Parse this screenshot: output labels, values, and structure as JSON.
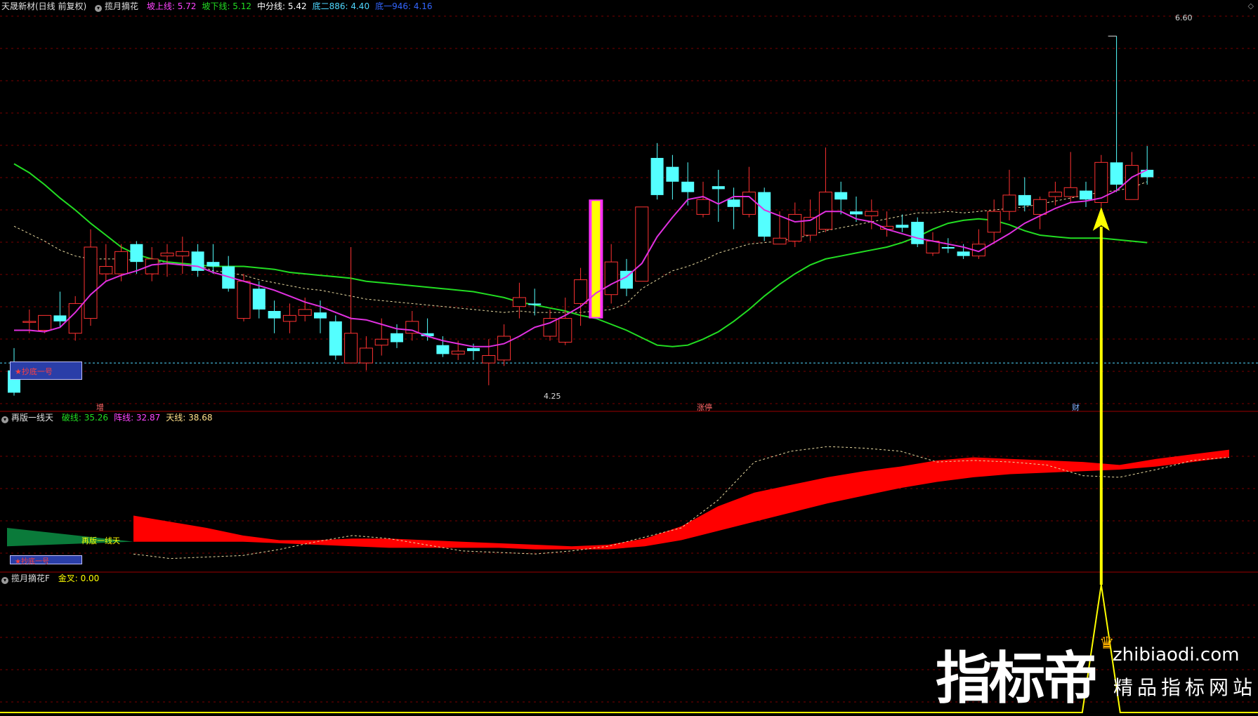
{
  "panel1": {
    "stock_name": "天晟新材(日线 前复权)",
    "indicator_name": "揽月摘花",
    "items": [
      {
        "label": "坡上线:",
        "value": "5.72",
        "color": "#ff44ff"
      },
      {
        "label": "坡下线:",
        "value": "5.12",
        "color": "#22dd22"
      },
      {
        "label": "中分线:",
        "value": "5.42",
        "color": "#ffffff"
      },
      {
        "label": "底二886:",
        "value": "4.40",
        "color": "#4fd8ff"
      },
      {
        "label": "底一946:",
        "value": "4.16",
        "color": "#3366ff"
      }
    ],
    "high_label": "6.60",
    "low_label": "4.25",
    "buy_box": "★抄底一号",
    "markers": [
      {
        "text": "增",
        "color": "#ff6a6a"
      },
      {
        "text": "涨停",
        "color": "#ff6a6a"
      },
      {
        "text": "财",
        "color": "#7fb0ff"
      }
    ]
  },
  "panel2": {
    "name": "再版一线天",
    "items": [
      {
        "label": "破线:",
        "value": "35.26",
        "color": "#22dd22"
      },
      {
        "label": "阵线:",
        "value": "32.87",
        "color": "#ff44ff"
      },
      {
        "label": "天线:",
        "value": "38.68",
        "color": "#ffe08a"
      }
    ],
    "inline_label": "再版一线天",
    "buy_box": "★抄底一号"
  },
  "panel3": {
    "name": "揽月摘花F",
    "items": [
      {
        "label": "金叉:",
        "value": "0.00",
        "color": "#ffff00"
      }
    ]
  },
  "watermark": {
    "brand": "指标帝",
    "domain": "zhibiaodi.com",
    "slogan": "精品指标网站"
  },
  "colors": {
    "up": "#ff3232",
    "down": "#54ffff",
    "grid": "#7a0000",
    "ma_purple": "#e030e0",
    "ma_green": "#22dd22",
    "arrow": "#ffff00"
  },
  "chart_data": {
    "type": "candlestick",
    "candles": [
      [
        4.35,
        4.2,
        4.5,
        4.18
      ],
      [
        4.68,
        4.68,
        4.76,
        4.6
      ],
      [
        4.62,
        4.72,
        4.72,
        4.6
      ],
      [
        4.72,
        4.68,
        4.88,
        4.64
      ],
      [
        4.6,
        4.8,
        4.85,
        4.55
      ],
      [
        4.7,
        5.18,
        5.3,
        4.65
      ],
      [
        5.0,
        5.05,
        5.2,
        4.95
      ],
      [
        5.0,
        5.15,
        5.2,
        4.95
      ],
      [
        5.2,
        5.08,
        5.22,
        5.0
      ],
      [
        5.0,
        5.1,
        5.18,
        4.95
      ],
      [
        5.12,
        5.14,
        5.2,
        4.98
      ],
      [
        5.12,
        5.15,
        5.25,
        5.0
      ],
      [
        5.15,
        5.02,
        5.2,
        4.98
      ],
      [
        5.08,
        5.05,
        5.2,
        5.0
      ],
      [
        5.05,
        4.9,
        5.12,
        4.88
      ],
      [
        4.7,
        4.95,
        5.0,
        4.68
      ],
      [
        4.9,
        4.76,
        4.95,
        4.7
      ],
      [
        4.75,
        4.7,
        4.82,
        4.6
      ],
      [
        4.68,
        4.72,
        4.8,
        4.6
      ],
      [
        4.72,
        4.76,
        4.84,
        4.68
      ],
      [
        4.74,
        4.7,
        4.82,
        4.6
      ],
      [
        4.68,
        4.45,
        4.72,
        4.42
      ],
      [
        4.4,
        4.6,
        5.18,
        4.4
      ],
      [
        4.4,
        4.5,
        4.58,
        4.35
      ],
      [
        4.52,
        4.56,
        4.7,
        4.45
      ],
      [
        4.6,
        4.54,
        4.66,
        4.5
      ],
      [
        4.6,
        4.68,
        4.75,
        4.55
      ],
      [
        4.6,
        4.58,
        4.7,
        4.55
      ],
      [
        4.52,
        4.46,
        4.58,
        4.44
      ],
      [
        4.46,
        4.48,
        4.55,
        4.42
      ],
      [
        4.5,
        4.48,
        4.53,
        4.42
      ],
      [
        4.4,
        4.45,
        4.56,
        4.25
      ],
      [
        4.42,
        4.58,
        4.66,
        4.38
      ],
      [
        4.78,
        4.84,
        4.94,
        4.7
      ],
      [
        4.8,
        4.79,
        4.9,
        4.72
      ],
      [
        4.58,
        4.7,
        4.76,
        4.55
      ],
      [
        4.54,
        4.7,
        4.84,
        4.52
      ],
      [
        4.8,
        4.96,
        5.04,
        4.65
      ],
      [
        4.72,
        5.26,
        5.5,
        4.7
      ],
      [
        4.86,
        5.08,
        5.2,
        4.8
      ],
      [
        5.02,
        4.9,
        5.1,
        4.85
      ],
      [
        4.95,
        5.45,
        5.45,
        4.95
      ],
      [
        5.78,
        5.53,
        5.88,
        5.5
      ],
      [
        5.72,
        5.62,
        5.8,
        5.5
      ],
      [
        5.62,
        5.55,
        5.75,
        5.46
      ],
      [
        5.4,
        5.5,
        5.62,
        5.38
      ],
      [
        5.59,
        5.57,
        5.7,
        5.35
      ],
      [
        5.5,
        5.45,
        5.58,
        5.3
      ],
      [
        5.4,
        5.55,
        5.72,
        5.38
      ],
      [
        5.55,
        5.25,
        5.58,
        5.22
      ],
      [
        5.2,
        5.24,
        5.42,
        5.2
      ],
      [
        5.22,
        5.4,
        5.48,
        5.18
      ],
      [
        5.26,
        5.38,
        5.5,
        5.22
      ],
      [
        5.3,
        5.55,
        5.85,
        5.28
      ],
      [
        5.55,
        5.5,
        5.62,
        5.4
      ],
      [
        5.42,
        5.4,
        5.52,
        5.35
      ],
      [
        5.39,
        5.42,
        5.5,
        5.3
      ],
      [
        5.3,
        5.32,
        5.42,
        5.25
      ],
      [
        5.33,
        5.31,
        5.4,
        5.28
      ],
      [
        5.35,
        5.2,
        5.38,
        5.18
      ],
      [
        5.14,
        5.22,
        5.28,
        5.12
      ],
      [
        5.18,
        5.17,
        5.24,
        5.14
      ],
      [
        5.15,
        5.12,
        5.2,
        5.1
      ],
      [
        5.12,
        5.2,
        5.3,
        5.1
      ],
      [
        5.28,
        5.42,
        5.5,
        5.2
      ],
      [
        5.42,
        5.53,
        5.7,
        5.36
      ],
      [
        5.53,
        5.46,
        5.65,
        5.42
      ],
      [
        5.4,
        5.5,
        5.52,
        5.3
      ],
      [
        5.52,
        5.55,
        5.62,
        5.46
      ],
      [
        5.52,
        5.58,
        5.82,
        5.48
      ],
      [
        5.56,
        5.5,
        5.62,
        5.45
      ],
      [
        5.48,
        5.75,
        5.8,
        5.45
      ],
      [
        5.75,
        5.6,
        6.6,
        5.55
      ],
      [
        5.5,
        5.73,
        5.82,
        5.5
      ],
      [
        5.7,
        5.65,
        5.86,
        5.6
      ]
    ],
    "special_candle_index": 38,
    "ma_purple": [
      4.62,
      4.62,
      4.61,
      4.64,
      4.74,
      4.86,
      4.95,
      4.99,
      5.02,
      5.06,
      5.07,
      5.06,
      5.05,
      5.01,
      4.98,
      4.95,
      4.92,
      4.89,
      4.85,
      4.81,
      4.78,
      4.74,
      4.7,
      4.69,
      4.66,
      4.63,
      4.62,
      4.58,
      4.55,
      4.53,
      4.51,
      4.51,
      4.53,
      4.58,
      4.64,
      4.67,
      4.72,
      4.78,
      4.87,
      4.93,
      4.98,
      5.07,
      5.25,
      5.38,
      5.5,
      5.52,
      5.47,
      5.52,
      5.52,
      5.43,
      5.39,
      5.35,
      5.36,
      5.42,
      5.42,
      5.37,
      5.35,
      5.3,
      5.27,
      5.24,
      5.22,
      5.2,
      5.18,
      5.15,
      5.21,
      5.27,
      5.34,
      5.39,
      5.44,
      5.48,
      5.49,
      5.51,
      5.56,
      5.65,
      5.7
    ],
    "ma_green": [
      5.74,
      5.68,
      5.6,
      5.51,
      5.43,
      5.34,
      5.26,
      5.18,
      5.13,
      5.1,
      5.08,
      5.07,
      5.06,
      5.05,
      5.05,
      5.05,
      5.04,
      5.03,
      5.01,
      5.0,
      4.99,
      4.98,
      4.97,
      4.95,
      4.94,
      4.93,
      4.92,
      4.91,
      4.9,
      4.89,
      4.88,
      4.86,
      4.84,
      4.81,
      4.79,
      4.77,
      4.75,
      4.72,
      4.7,
      4.66,
      4.62,
      4.57,
      4.52,
      4.51,
      4.52,
      4.56,
      4.61,
      4.68,
      4.76,
      4.85,
      4.93,
      5.0,
      5.06,
      5.1,
      5.12,
      5.14,
      5.16,
      5.18,
      5.21,
      5.25,
      5.3,
      5.34,
      5.36,
      5.37,
      5.36,
      5.33,
      5.29,
      5.26,
      5.25,
      5.24,
      5.24,
      5.24,
      5.23,
      5.22,
      5.21
    ],
    "ma_dash": [
      5.32,
      5.27,
      5.22,
      5.16,
      5.12,
      5.1,
      5.1,
      5.1,
      5.09,
      5.08,
      5.08,
      5.07,
      5.06,
      5.02,
      5.01,
      4.99,
      4.96,
      4.94,
      4.92,
      4.9,
      4.89,
      4.87,
      4.85,
      4.83,
      4.82,
      4.81,
      4.8,
      4.79,
      4.78,
      4.77,
      4.76,
      4.75,
      4.74,
      4.75,
      4.74,
      4.74,
      4.74,
      4.74,
      4.75,
      4.76,
      4.8,
      4.9,
      4.96,
      5.02,
      5.05,
      5.09,
      5.14,
      5.17,
      5.2,
      5.21,
      5.22,
      5.24,
      5.26,
      5.29,
      5.31,
      5.33,
      5.35,
      5.37,
      5.39,
      5.41,
      5.41,
      5.42,
      5.41,
      5.42,
      5.43,
      5.44,
      5.45,
      5.47,
      5.49,
      5.51,
      5.53,
      5.55,
      5.56,
      5.58,
      5.62
    ],
    "bottom_line": 4.4,
    "y_range": [
      4.15,
      6.72
    ],
    "panel2": {
      "red_upper": [
        36,
        35.6,
        35.2,
        34.7,
        34.4,
        34.4,
        34.5,
        34.5,
        34.4,
        34.3,
        34.2,
        34.1,
        34.0,
        34.1,
        34.5,
        35.3,
        36.6,
        37.5,
        38.0,
        38.5,
        38.9,
        39.2,
        39.6,
        39.8,
        39.7,
        39.6,
        39.5,
        39.3,
        39.7,
        40.0,
        40.3
      ],
      "red_lower": [
        34.3,
        34.3,
        34.3,
        34.3,
        34.2,
        34.1,
        34.0,
        33.9,
        33.9,
        33.9,
        33.9,
        33.8,
        33.8,
        33.8,
        34.0,
        34.4,
        35.0,
        35.6,
        36.2,
        36.8,
        37.3,
        37.8,
        38.2,
        38.5,
        38.7,
        38.8,
        38.9,
        39.0,
        39.2,
        39.5,
        39.8
      ],
      "green_upper": [
        35.2,
        34.8
      ],
      "green_lower": [
        34.0,
        34.3
      ],
      "dashed": [
        33.5,
        33.2,
        33.3,
        33.4,
        33.8,
        34.3,
        34.7,
        34.5,
        34.1,
        33.7,
        33.6,
        33.5,
        33.7,
        34.0,
        34.6,
        35.2,
        37.0,
        39.5,
        40.2,
        40.5,
        40.4,
        40.2,
        39.5,
        39.6,
        39.5,
        39.3,
        38.6,
        38.5,
        39.0,
        39.6,
        39.8
      ],
      "y_range": [
        32.5,
        41.7
      ]
    },
    "panel3": {
      "signal_index": 71,
      "values_pre": 0.0,
      "value_now": 0.0
    }
  }
}
